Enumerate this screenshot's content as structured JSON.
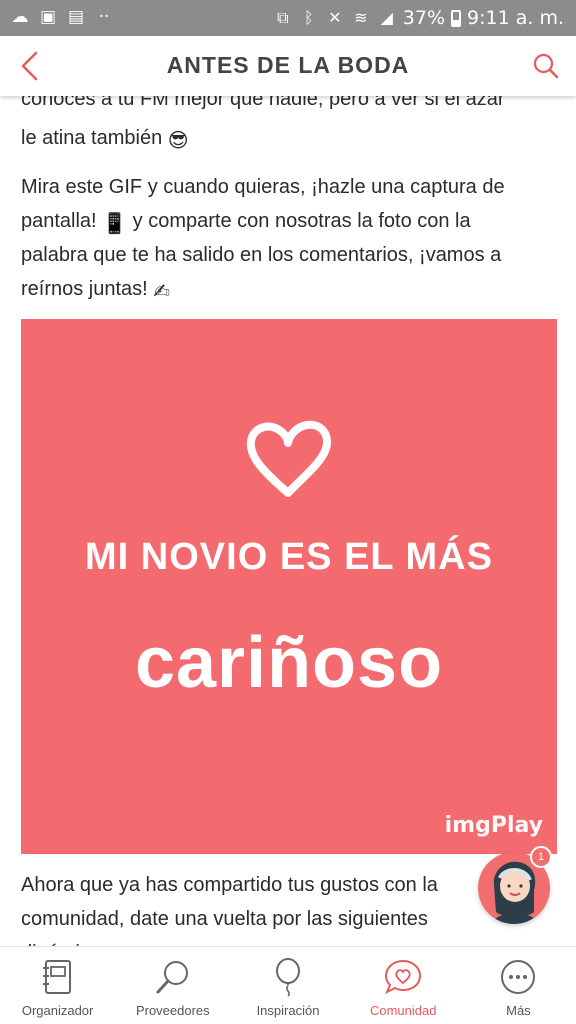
{
  "status_bar": {
    "battery": "37%",
    "time": "9:11 a. m.",
    "left_icons": [
      "weather-icon",
      "image-icon",
      "calendar-icon",
      "more-dots-icon"
    ],
    "right_icons": [
      "nfc-icon",
      "bluetooth-icon",
      "mute-icon",
      "wifi-icon",
      "signal-icon",
      "battery-icon"
    ]
  },
  "header": {
    "title": "ANTES DE LA BODA",
    "back_icon": "chevron-left-icon",
    "search_icon": "search-icon",
    "accent_color": "#e8595d"
  },
  "content": {
    "para1_line1": "conoces a tu FM mejor que nadie, pero a ver si el azar",
    "para1_line2": "le atina también",
    "para1_emoji": "😎",
    "para2_line1": "Mira este GIF y cuando quieras, ¡hazle una captura de",
    "para2_line2a": "pantalla!",
    "para2_emoji_phone": "📱",
    "para2_line2b": "y comparte con nosotras la foto con la",
    "para2_line3": "palabra que te ha salido en los comentarios, ¡vamos a",
    "para2_line4": "reírnos juntas!",
    "para2_emoji_write": "✍",
    "gif": {
      "line1": "MI NOVIO ES EL MÁS",
      "line2": "cariñoso",
      "watermark": "imgPlay",
      "background": "#f46b6f"
    },
    "para3_line1": "Ahora que ya has compartido tus gustos con la",
    "para3_line2": "comunidad, date una vuelta por las siguientes",
    "para3_line3": "dinámicas"
  },
  "floating": {
    "badge": "1"
  },
  "bottom_nav": [
    {
      "label": "Organizador",
      "icon": "planner-icon",
      "active": false
    },
    {
      "label": "Proveedores",
      "icon": "magnifier-icon",
      "active": false
    },
    {
      "label": "Inspiración",
      "icon": "balloon-icon",
      "active": false
    },
    {
      "label": "Comunidad",
      "icon": "heart-chat-icon",
      "active": true
    },
    {
      "label": "Más",
      "icon": "more-circle-icon",
      "active": false
    }
  ]
}
